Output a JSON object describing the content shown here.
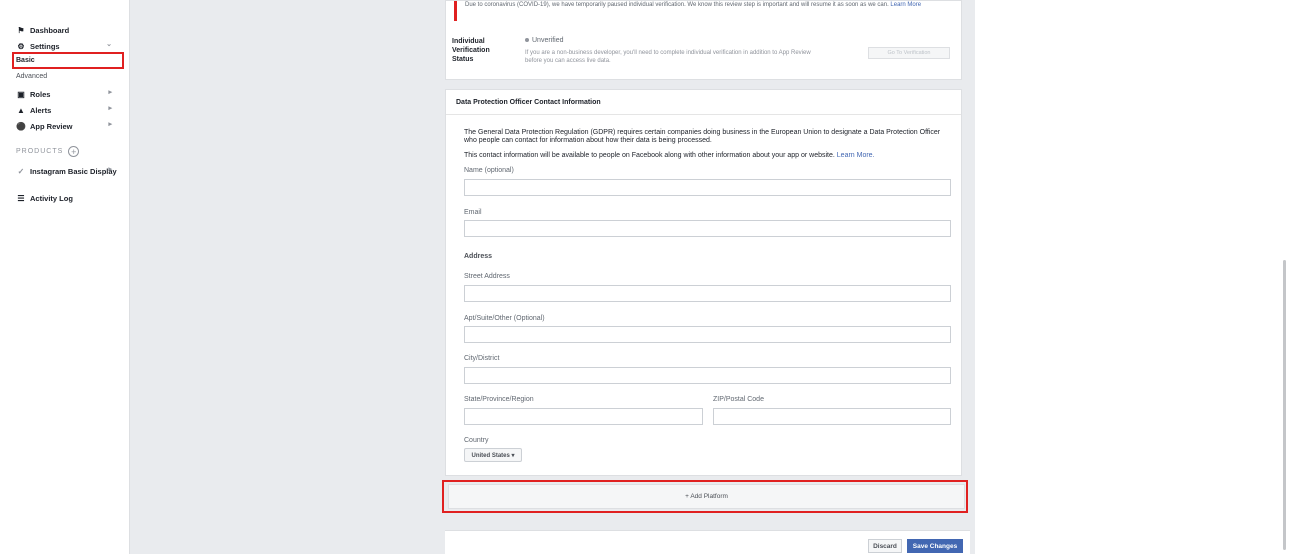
{
  "sidebar": {
    "dashboard": "Dashboard",
    "settings": "Settings",
    "basic": "Basic",
    "advanced": "Advanced",
    "roles": "Roles",
    "alerts": "Alerts",
    "app_review": "App Review",
    "products_heading": "PRODUCTS",
    "instagram": "Instagram Basic Display",
    "activity_log": "Activity Log"
  },
  "verification": {
    "notice_text": "Due to coronavirus (COVID-19), we have temporarily paused individual verification. We know this review step is important and will resume it as soon as we can.",
    "notice_link": "Learn More",
    "label": "Individual Verification Status",
    "status": "Unverified",
    "description": "If you are a non-business developer, you'll need to complete individual verification in addition to App Review before you can access live data.",
    "button": "Go To Verification"
  },
  "dpo": {
    "title": "Data Protection Officer Contact Information",
    "description": "The General Data Protection Regulation (GDPR) requires certain companies doing business in the European Union to designate a Data Protection Officer who people can contact for information about how their data is being processed.",
    "description2": "This contact information will be available to people on Facebook along with other information about your app or website.",
    "learn_more": "Learn More.",
    "name_label": "Name (optional)",
    "email_label": "Email",
    "address_heading": "Address",
    "street_label": "Street Address",
    "apt_label": "Apt/Suite/Other (Optional)",
    "city_label": "City/District",
    "state_label": "State/Province/Region",
    "zip_label": "ZIP/Postal Code",
    "country_label": "Country",
    "country_value": "United States ▾"
  },
  "add_platform": "+ Add Platform",
  "footer": {
    "discard": "Discard",
    "save": "Save Changes"
  },
  "colors": {
    "highlight": "#e02020",
    "primary": "#4267b2"
  }
}
